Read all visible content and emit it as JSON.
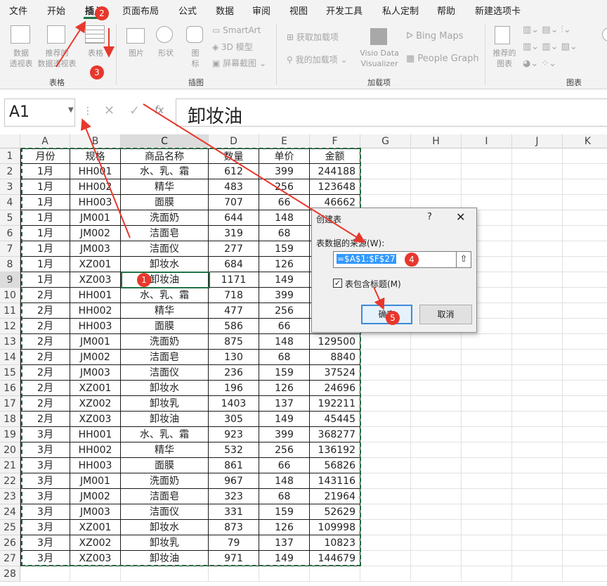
{
  "menu": {
    "tabs": [
      {
        "label": "文件"
      },
      {
        "label": "开始"
      },
      {
        "label": "插入"
      },
      {
        "label": "页面布局"
      },
      {
        "label": "公式"
      },
      {
        "label": "数据"
      },
      {
        "label": "审阅"
      },
      {
        "label": "视图"
      },
      {
        "label": "开发工具"
      },
      {
        "label": "私人定制"
      },
      {
        "label": "帮助"
      },
      {
        "label": "新建选项卡"
      }
    ]
  },
  "ribbon": {
    "groups": {
      "tables": "表格",
      "illustrations": "插图",
      "addins": "加载项",
      "charts": "图表"
    },
    "pivot_table": "数据\n透视表",
    "recommended_pivot": "推荐的\n数据透视表",
    "table": "表格",
    "pictures": "图片",
    "shapes": "形状",
    "icons": "图\n标",
    "smartart": "SmartArt",
    "model3d": "3D 模型",
    "screenshot": "屏幕截图",
    "get_addins": "获取加载项",
    "my_addins": "我的加载项",
    "visio": "Visio Data\nVisualizer",
    "bing_maps": "Bing Maps",
    "people_graph": "People Graph",
    "recommended_charts": "推荐的\n图表"
  },
  "formula_bar": {
    "name_box": "A1",
    "content": "卸妆油"
  },
  "sheet": {
    "columns": [
      "A",
      "B",
      "C",
      "D",
      "E",
      "F",
      "G",
      "H",
      "I",
      "J",
      "K"
    ],
    "headers": [
      "月份",
      "规格",
      "商品名称",
      "数量",
      "单价",
      "金额"
    ],
    "rows": [
      [
        "1月",
        "HH001",
        "水、乳、霜",
        "612",
        "399",
        "244188"
      ],
      [
        "1月",
        "HH002",
        "精华",
        "483",
        "256",
        "123648"
      ],
      [
        "1月",
        "HH003",
        "面膜",
        "707",
        "66",
        "46662"
      ],
      [
        "1月",
        "JM001",
        "洗面奶",
        "644",
        "148",
        ""
      ],
      [
        "1月",
        "JM002",
        "洁面皂",
        "319",
        "68",
        ""
      ],
      [
        "1月",
        "JM003",
        "洁面仪",
        "277",
        "159",
        ""
      ],
      [
        "1月",
        "XZ001",
        "卸妆水",
        "684",
        "126",
        ""
      ],
      [
        "1月",
        "XZ003",
        "卸妆油",
        "1171",
        "149",
        ""
      ],
      [
        "2月",
        "HH001",
        "水、乳、霜",
        "718",
        "399",
        ""
      ],
      [
        "2月",
        "HH002",
        "精华",
        "477",
        "256",
        ""
      ],
      [
        "2月",
        "HH003",
        "面膜",
        "586",
        "66",
        ""
      ],
      [
        "2月",
        "JM001",
        "洗面奶",
        "875",
        "148",
        "129500"
      ],
      [
        "2月",
        "JM002",
        "洁面皂",
        "130",
        "68",
        "8840"
      ],
      [
        "2月",
        "JM003",
        "洁面仪",
        "236",
        "159",
        "37524"
      ],
      [
        "2月",
        "XZ001",
        "卸妆水",
        "196",
        "126",
        "24696"
      ],
      [
        "2月",
        "XZ002",
        "卸妆乳",
        "1403",
        "137",
        "192211"
      ],
      [
        "2月",
        "XZ003",
        "卸妆油",
        "305",
        "149",
        "45445"
      ],
      [
        "3月",
        "HH001",
        "水、乳、霜",
        "923",
        "399",
        "368277"
      ],
      [
        "3月",
        "HH002",
        "精华",
        "532",
        "256",
        "136192"
      ],
      [
        "3月",
        "HH003",
        "面膜",
        "861",
        "66",
        "56826"
      ],
      [
        "3月",
        "JM001",
        "洗面奶",
        "967",
        "148",
        "143116"
      ],
      [
        "3月",
        "JM002",
        "洁面皂",
        "323",
        "68",
        "21964"
      ],
      [
        "3月",
        "JM003",
        "洁面仪",
        "331",
        "159",
        "52629"
      ],
      [
        "3月",
        "XZ001",
        "卸妆水",
        "873",
        "126",
        "109998"
      ],
      [
        "3月",
        "XZ002",
        "卸妆乳",
        "79",
        "137",
        "10823"
      ],
      [
        "3月",
        "XZ003",
        "卸妆油",
        "971",
        "149",
        "144679"
      ]
    ],
    "row_count": 28
  },
  "dialog": {
    "title": "创建表",
    "help": "?",
    "close": "✕",
    "range_label": "表数据的来源(W):",
    "range_value": "=$A$1:$F$27",
    "collapse_icon": "⇧",
    "has_headers_label": "表包含标题(M)",
    "has_headers_checked": true,
    "ok_label": "确定",
    "cancel_label": "取消"
  },
  "annotations": {
    "badges": [
      "1",
      "2",
      "3",
      "4",
      "5"
    ],
    "color": "#e8372c"
  },
  "colors": {
    "accent": "#217346",
    "selection_dash": "#1e6b3a",
    "highlight": "#3399ff"
  }
}
